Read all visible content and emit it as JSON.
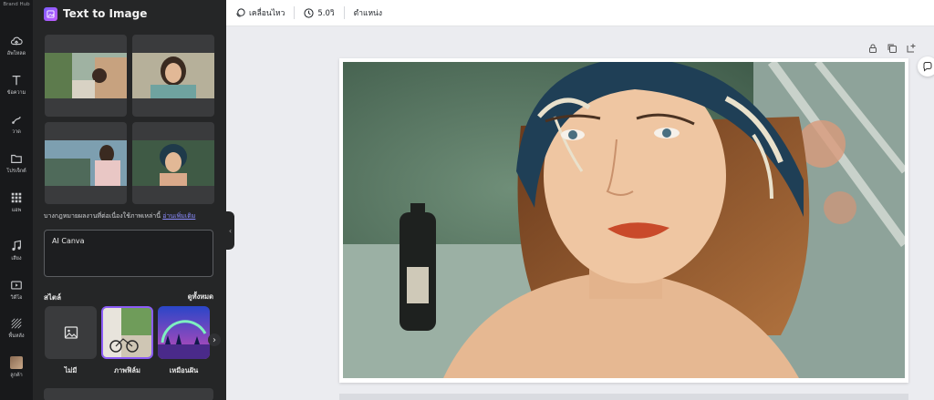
{
  "rail": {
    "top_label": "Brand Hub",
    "items": [
      {
        "label": "อัพโหลด",
        "icon": "cloud-upload-icon"
      },
      {
        "label": "ข้อความ",
        "icon": "text-icon"
      },
      {
        "label": "วาด",
        "icon": "draw-icon"
      },
      {
        "label": "โปรเจ็กต์",
        "icon": "folder-icon"
      },
      {
        "label": "แอพ",
        "icon": "apps-grid-icon"
      },
      {
        "label": "เสียง",
        "icon": "music-note-icon"
      },
      {
        "label": "วิดีโอ",
        "icon": "video-icon"
      },
      {
        "label": "พื้นหลัง",
        "icon": "background-pattern-icon"
      },
      {
        "label": "ลูกค้า",
        "icon": "photo-thumbnail-icon"
      }
    ]
  },
  "panel": {
    "title": "Text to Image",
    "caption_text": "บางกฎหมายผลงานที่ต่อเนื่องใช้ภาพเหล่านี้",
    "caption_link": "อ่านเพิ่มเติม",
    "prompt_value": "AI Canva",
    "style_label": "สไตล์",
    "see_all": "ดูทั้งหมด",
    "styles": [
      {
        "name": "ไม่มี",
        "icon": "image-placeholder-icon"
      },
      {
        "name": "ภาพฟิล์ม"
      },
      {
        "name": "เหมือนฝัน"
      }
    ]
  },
  "topbar": {
    "animate": "เคลื่อนไหว",
    "duration": "5.0วิ",
    "position": "ตำแหน่ง"
  },
  "colors": {
    "accent": "#8b5cf6",
    "panel_bg": "#252627",
    "rail_bg": "#18191b",
    "canvas_bg": "#ebecf0"
  }
}
